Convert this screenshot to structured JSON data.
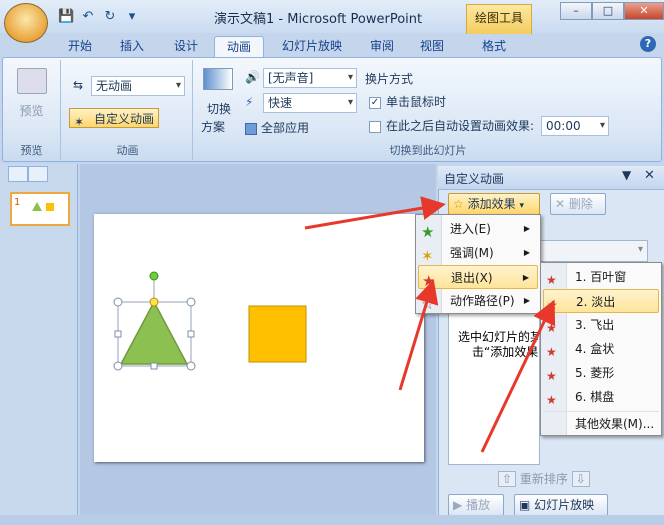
{
  "window": {
    "title": "演示文稿1 - Microsoft PowerPoint",
    "context_tab": "绘图工具",
    "controls": {
      "minimize": "–",
      "maximize": "□",
      "close": "✕"
    }
  },
  "qat": {
    "save": "💾",
    "undo": "↶",
    "redo": "↻",
    "more": "▾"
  },
  "tabs": [
    "开始",
    "插入",
    "设计",
    "动画",
    "幻灯片放映",
    "审阅",
    "视图",
    "格式"
  ],
  "active_tab": "动画",
  "ribbon": {
    "preview_group": {
      "preview_label": "预览",
      "group_label": "预览"
    },
    "animation_group": {
      "animate_value": "无动画",
      "custom_animation": "自定义动画",
      "group_label": "动画"
    },
    "transition_group": {
      "scheme_label_1": "切换",
      "scheme_label_2": "方案",
      "sound_value": "[无声音]",
      "speed_value": "快速",
      "apply_all": "全部应用",
      "advance_title": "换片方式",
      "on_click": "单击鼠标时",
      "auto_after": "在此之后自动设置动画效果:",
      "auto_time": "00:00",
      "group_label": "切换到此幻灯片"
    }
  },
  "slide_panel": {
    "slide_number": "1"
  },
  "task_pane": {
    "title": "自定义动画",
    "add_effect": "添加效果",
    "remove": "删除",
    "hint_line1": "选中幻灯片的某",
    "hint_line2": "击“添加效果",
    "reorder": "重新排序",
    "play": "播放",
    "slideshow": "幻灯片放映"
  },
  "effect_menu": {
    "items": [
      {
        "label": "进入(E)",
        "underline": "E"
      },
      {
        "label": "强调(M)",
        "underline": "M"
      },
      {
        "label": "退出(X)",
        "underline": "X"
      },
      {
        "label": "动作路径(P)",
        "underline": "P"
      }
    ],
    "highlighted": 2
  },
  "exit_submenu": {
    "items": [
      "1. 百叶窗",
      "2. 淡出",
      "3. 飞出",
      "4. 盒状",
      "5. 菱形",
      "6. 棋盘"
    ],
    "more": "其他效果(M)...",
    "highlighted": 1
  },
  "colors": {
    "triangle": "#8cc152",
    "square": "#ffc000",
    "arrow": "#e8382b"
  }
}
